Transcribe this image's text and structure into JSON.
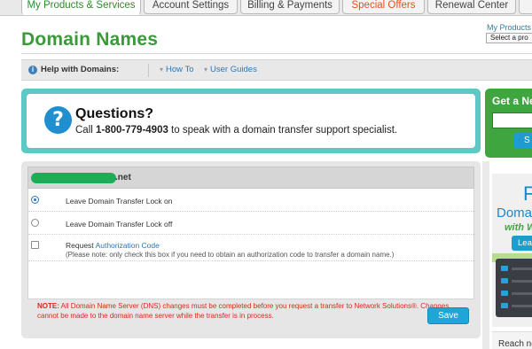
{
  "tabs": [
    {
      "label": "My Products & Services",
      "state": "active"
    },
    {
      "label": "Account Settings"
    },
    {
      "label": "Billing & Payments"
    },
    {
      "label": "Special Offers",
      "color": "#e8501b"
    },
    {
      "label": "Renewal Center"
    }
  ],
  "page": {
    "title": "Domain Names"
  },
  "product_selector": {
    "label": "My Products",
    "value": "Select a pro"
  },
  "help_bar": {
    "label": "Help with Domains:",
    "links": [
      "How To",
      "User Guides"
    ]
  },
  "questions": {
    "title": "Questions?",
    "text_before": "Call ",
    "phone": "1-800-779-4903",
    "text_after": " to speak with a domain transfer support specialist."
  },
  "domain_panel": {
    "domain_suffix": ".net",
    "options": [
      {
        "type": "radio",
        "label": "Leave Domain Transfer Lock on",
        "checked": true
      },
      {
        "type": "radio",
        "label": "Leave Domain Transfer Lock off",
        "checked": false
      },
      {
        "type": "checkbox",
        "label_prefix": "Request ",
        "label_link": "Authorization Code",
        "note": "(Please note: only check this box if you need to obtain an authorization code to transfer a domain name.)",
        "checked": false
      }
    ],
    "note_label": "NOTE:",
    "note_text": " All Domain Name Server (DNS) changes must be completed before you request a transfer to Network Solutions®. Changes cannot be made to the domain name server while the transfer is in process.",
    "save_label": "Save"
  },
  "promo": {
    "top_title": "Get a Ne",
    "top_button": "S",
    "mid_big": "F",
    "mid_line1": "Doma",
    "mid_line2": "with W",
    "mid_button": "Lea",
    "bottom_text": "Reach ne"
  },
  "colors": {
    "brand_green": "#3a9a3a",
    "teal": "#5cc9c4",
    "link_blue": "#2f76b2",
    "button_blue": "#1fa5d8",
    "offer_orange": "#e8501b",
    "note_red": "#d9291c"
  },
  "icons": [
    "info-icon",
    "question-mark-icon",
    "server-icon"
  ]
}
